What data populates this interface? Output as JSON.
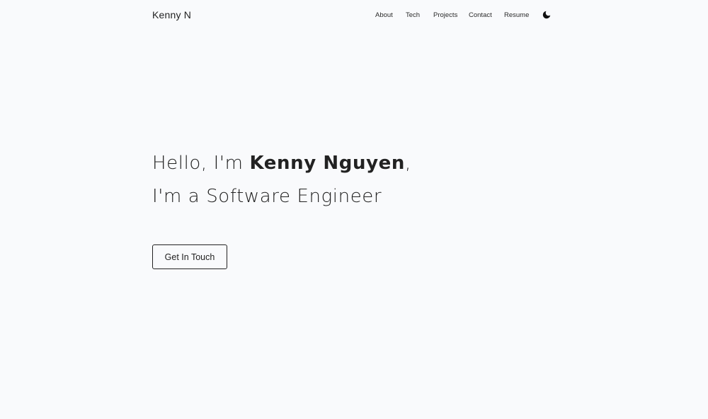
{
  "nav": {
    "brand": "Kenny N",
    "links": [
      "About",
      "Tech",
      "Projects",
      "Contact",
      "Resume"
    ],
    "theme_toggle_icon": "moon-icon"
  },
  "hero": {
    "greeting_prefix": "Hello, I'm ",
    "name": "Kenny Nguyen",
    "greeting_suffix": ",",
    "tagline": "I'm a Software Engineer",
    "cta_label": "Get In Touch"
  },
  "colors": {
    "background": "#f9fafc",
    "text": "#222222"
  }
}
